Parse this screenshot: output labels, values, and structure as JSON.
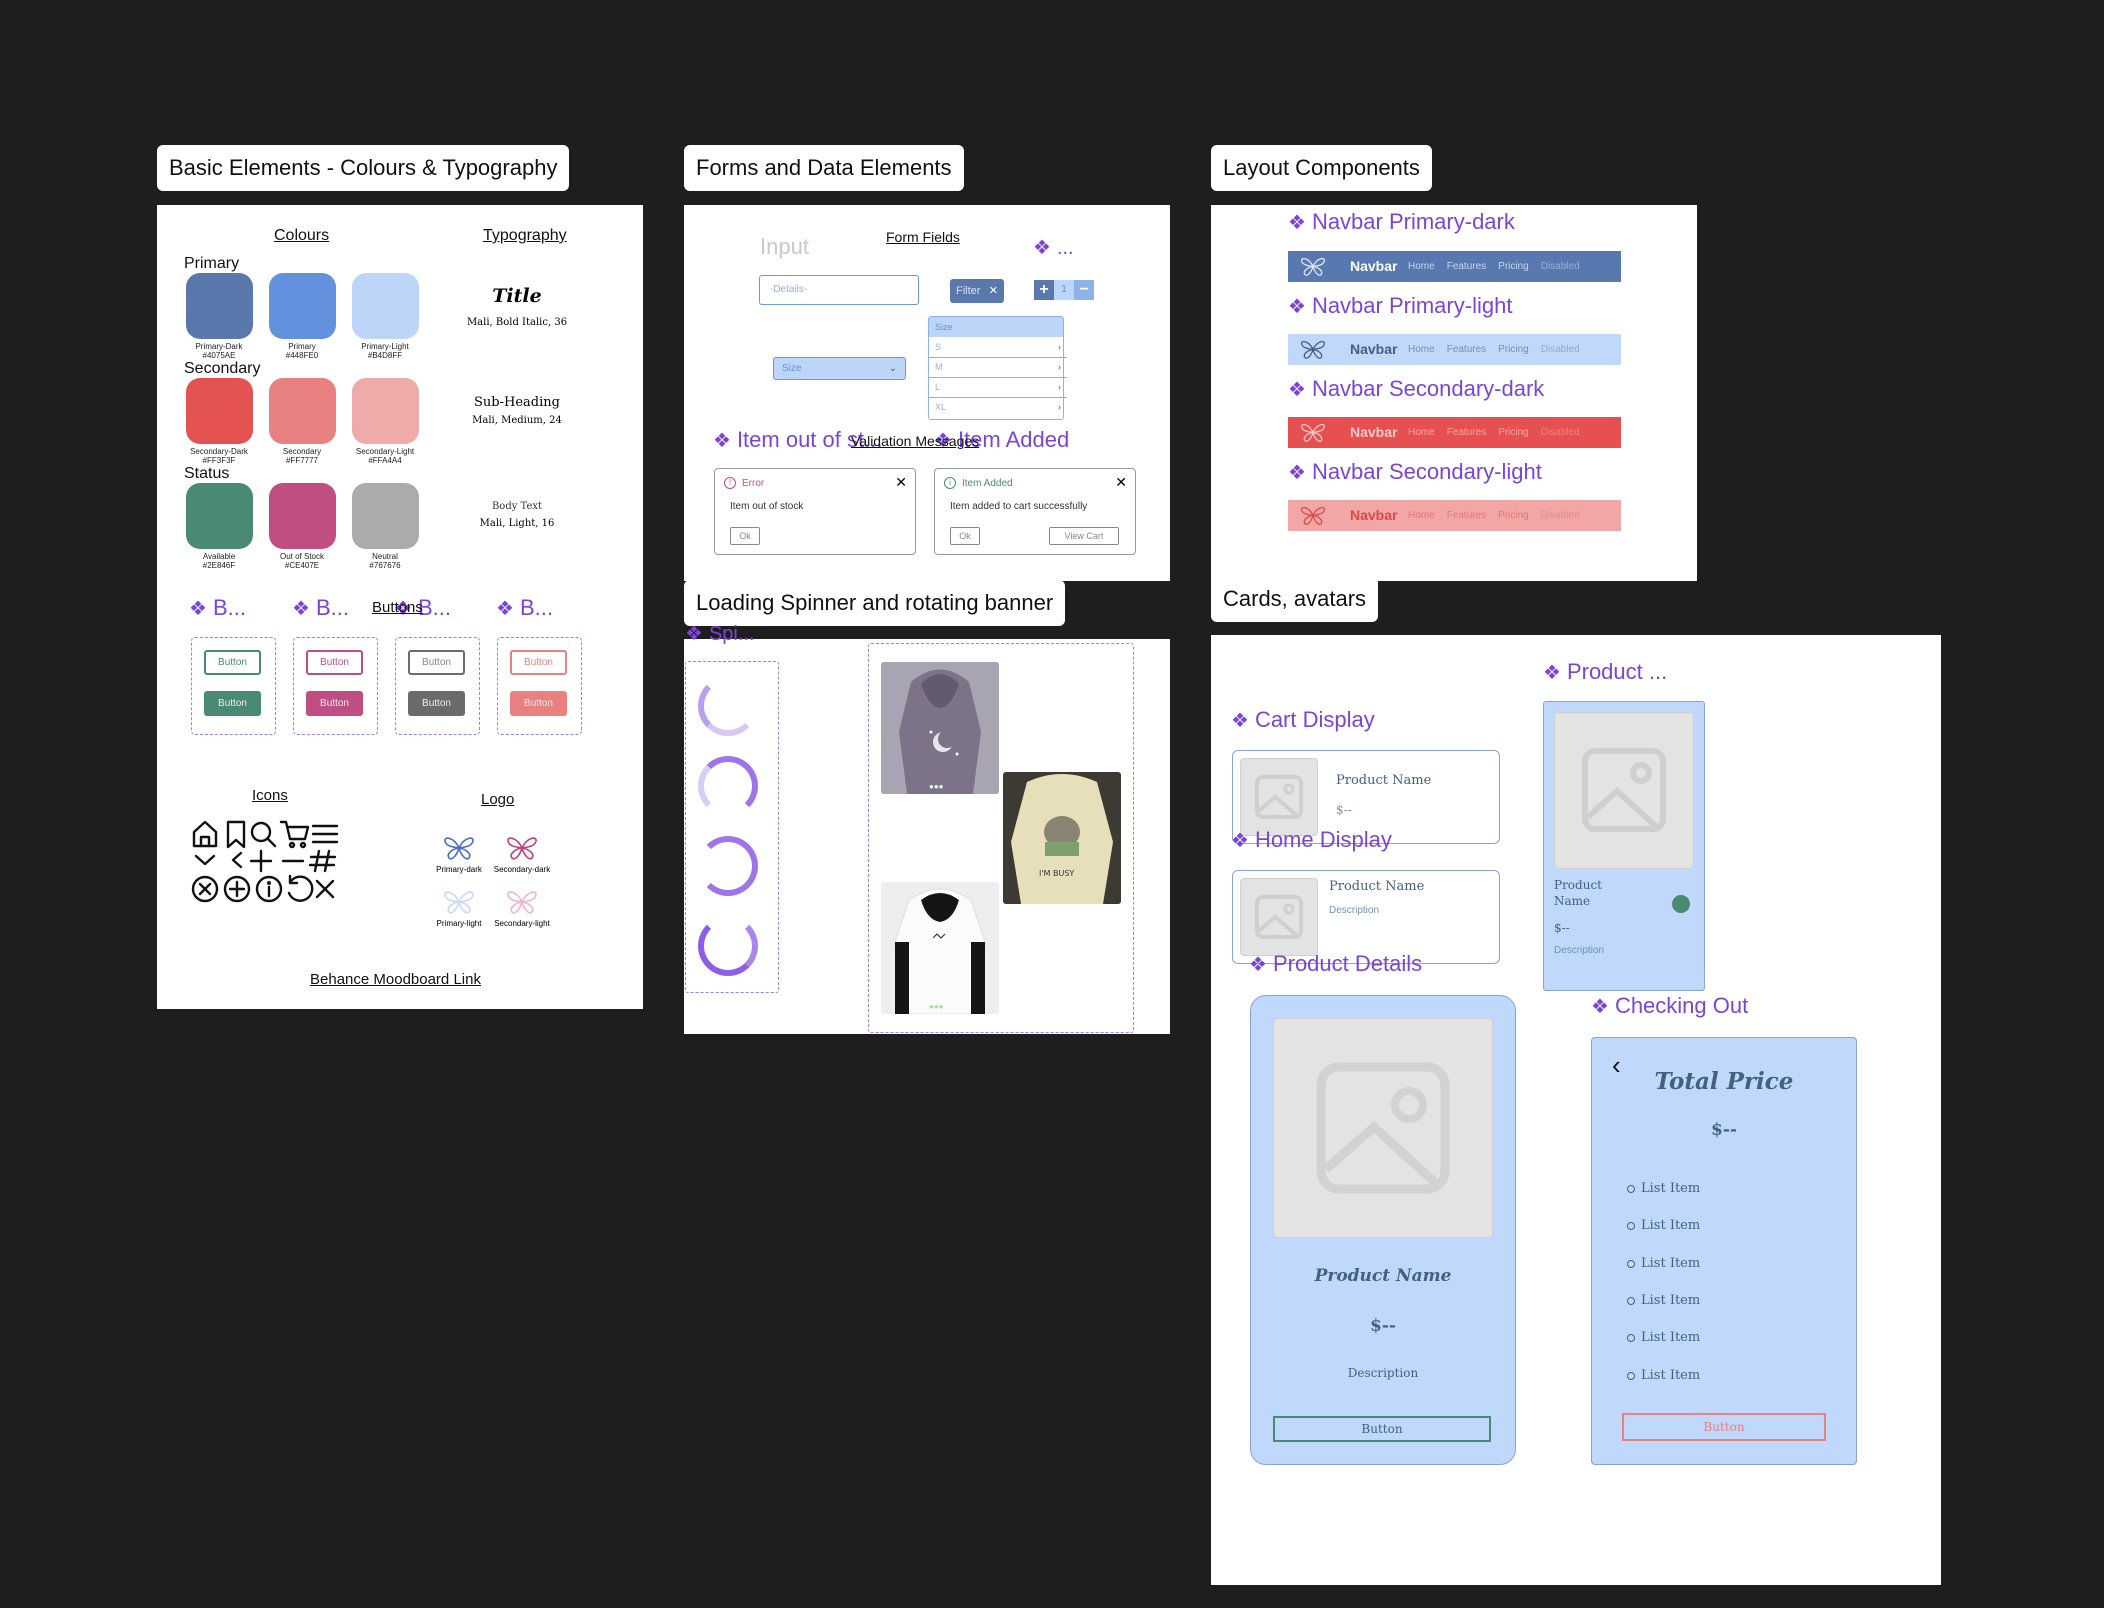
{
  "colors": {
    "canvas": "#1e1e1e",
    "primary_dark": "#4075AE",
    "primary": "#448FE0",
    "primary_light": "#B4D8FF",
    "secondary_dark": "#FF3F3F",
    "secondary": "#FF7777",
    "secondary_light": "#FFA4A4",
    "available": "#2E846F",
    "out_of_stock": "#CE407E",
    "neutral": "#767676",
    "component_purple": "#7b44d8"
  },
  "frames": {
    "basic": "Basic Elements - Colours & Typography",
    "forms": "Forms and Data Elements",
    "layout": "Layout Components",
    "loading": "Loading Spinner and rotating banner",
    "cards": "Cards, avatars"
  },
  "basic": {
    "colours_heading": "Colours",
    "typography_heading": "Typography",
    "group_primary": "Primary",
    "group_secondary": "Secondary",
    "group_status": "Status",
    "swatches": [
      {
        "name": "Primary-Dark",
        "hex": "#4075AE"
      },
      {
        "name": "Primary",
        "hex": "#448FE0"
      },
      {
        "name": "Primary-Light",
        "hex": "#B4D8FF"
      },
      {
        "name": "Secondary-Dark",
        "hex": "#FF3F3F"
      },
      {
        "name": "Secondary",
        "hex": "#FF7777"
      },
      {
        "name": "Secondary-Light",
        "hex": "#FFA4A4"
      },
      {
        "name": "Available",
        "hex": "#2E846F"
      },
      {
        "name": "Out of Stock",
        "hex": "#CE407E"
      },
      {
        "name": "Neutral",
        "hex": "#767676"
      }
    ],
    "typo": {
      "title": "Title",
      "title_spec": "Mali, Bold Italic, 36",
      "subheading": "Sub-Heading",
      "subheading_spec": "Mali, Medium, 24",
      "body": "Body Text",
      "body_spec": "Mali, Light, 16"
    },
    "buttons_heading": "Buttons",
    "button_components": [
      "B...",
      "B...",
      "B...",
      "B..."
    ],
    "button_label": "Button",
    "icons_heading": "Icons",
    "logo_heading": "Logo",
    "logos": [
      "Primary-dark",
      "Secondary-dark",
      "Primary-light",
      "Secondary-light"
    ],
    "link": "Behance Moodboard Link"
  },
  "forms": {
    "input_label": "Input",
    "form_fields_heading": "Form Fields",
    "details_placeholder": "-Details-",
    "filter_chip": "Filter",
    "stepper_component": "...",
    "stepper_value": "1",
    "size_select": "Size",
    "size_list_header": "Size",
    "size_options": [
      "S",
      "M",
      "L",
      "XL"
    ],
    "validation_heading": "Validation Messages",
    "comp_out_of_stock": "Item out of st...",
    "comp_item_added": "Item Added",
    "error_title": "Error",
    "error_text": "Item out of stock",
    "ok": "Ok",
    "added_title": "Item Added",
    "added_text": "Item added to cart successfully",
    "view_cart": "View Cart"
  },
  "layout": {
    "navbars": [
      {
        "label": "Navbar Primary-dark",
        "bg": "#5878b0",
        "fg": "#ffffff",
        "links_fg": "#c7d6f0"
      },
      {
        "label": "Navbar Primary-light",
        "bg": "#bfd8fb",
        "fg": "#45607f",
        "links_fg": "#7390b3"
      },
      {
        "label": "Navbar Secondary-dark",
        "bg": "#e65050",
        "fg": "#f8c9c9",
        "links_fg": "#f8a3a3"
      },
      {
        "label": "Navbar Secondary-light",
        "bg": "#f2a6a6",
        "fg": "#d94a4a",
        "links_fg": "#e87777"
      }
    ],
    "brand": "Navbar",
    "links": [
      "Home",
      "Features",
      "Pricing",
      "Disabled"
    ]
  },
  "loading": {
    "spinner_component": "Spi..."
  },
  "cards": {
    "product_component": "Product ...",
    "cart_display": "Cart Display",
    "home_display": "Home Display",
    "product_details": "Product Details",
    "checking_out": "Checking Out",
    "product_name": "Product Name",
    "product_name_wrap_1": "Product",
    "product_name_wrap_2": "Name",
    "price": "$--",
    "description": "Description",
    "button": "Button",
    "total_price": "Total Price",
    "list_items": [
      "List Item",
      "List Item",
      "List Item",
      "List Item",
      "List Item",
      "List Item"
    ]
  }
}
